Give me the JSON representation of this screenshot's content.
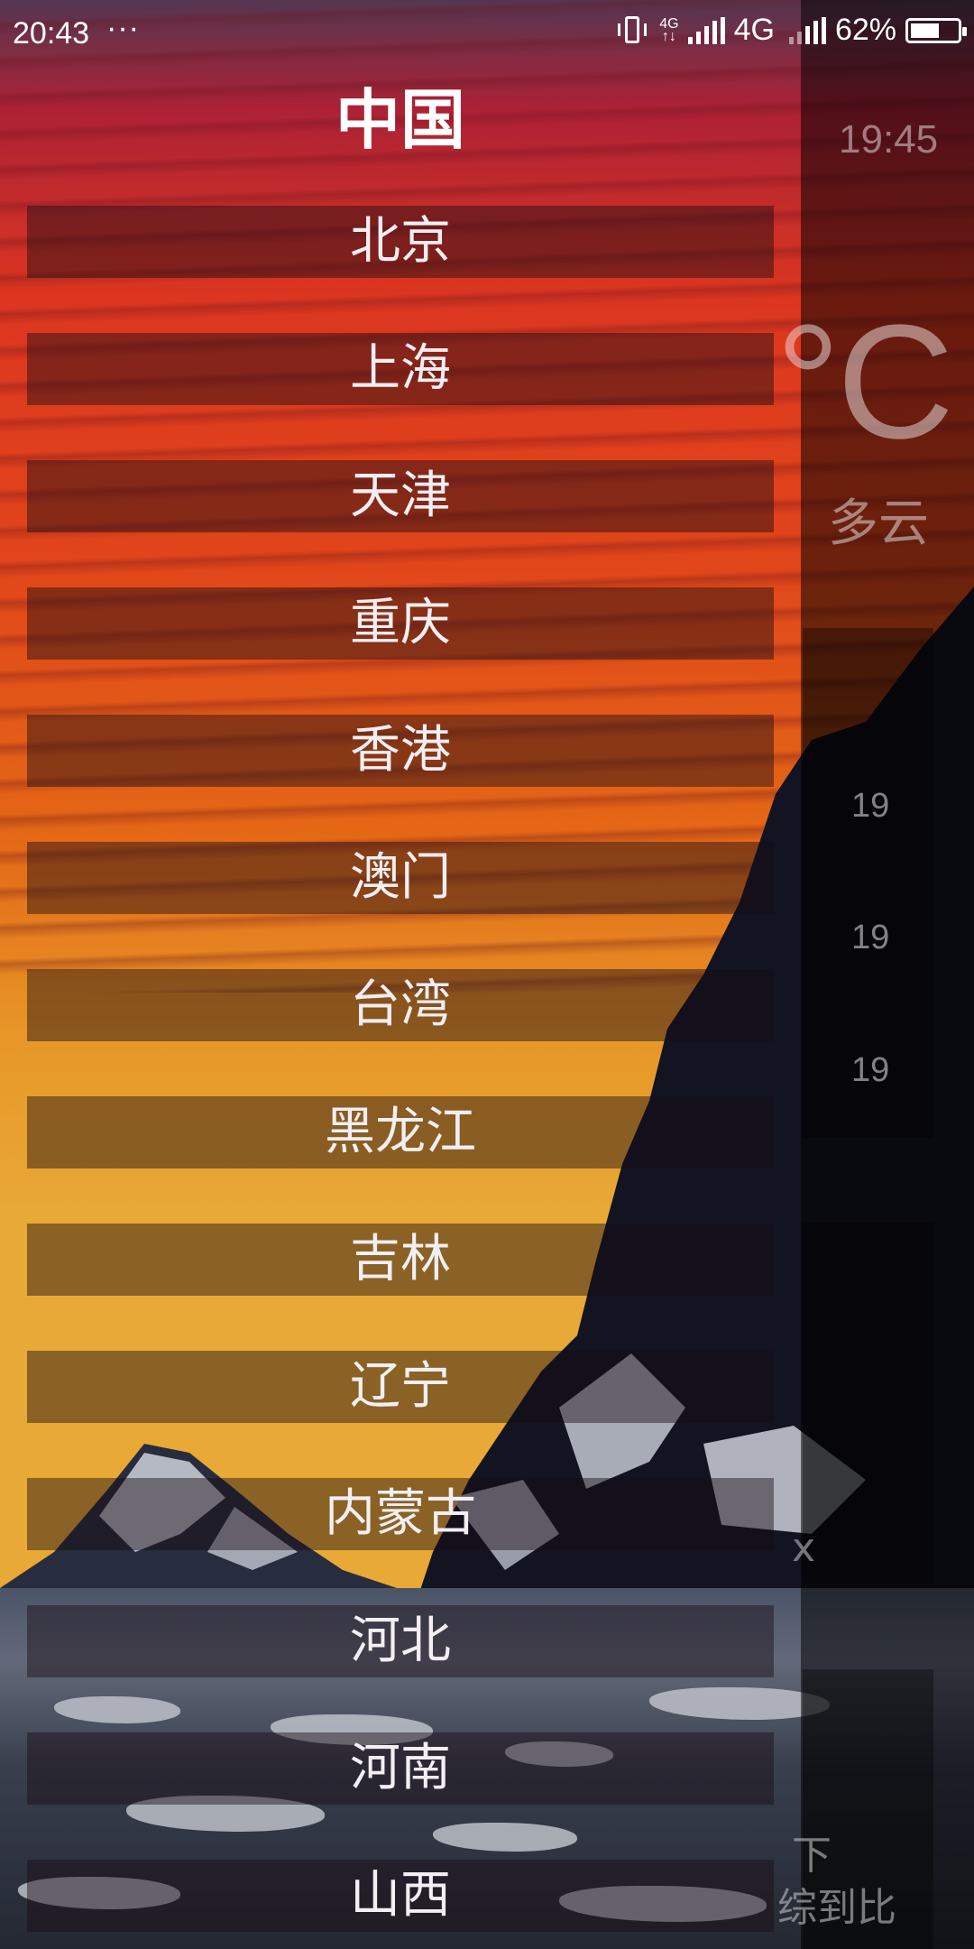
{
  "status_bar": {
    "time": "20:43",
    "more": "···",
    "network_small": "4G",
    "network": "4G",
    "battery": "62%",
    "battery_level": 0.62,
    "icons": [
      "vibrate-icon",
      "signal-icon",
      "battery-icon"
    ]
  },
  "drawer": {
    "title": "中国",
    "items": [
      "北京",
      "上海",
      "天津",
      "重庆",
      "香港",
      "澳门",
      "台湾",
      "黑龙江",
      "吉林",
      "辽宁",
      "内蒙古",
      "河北",
      "河南",
      "山西"
    ]
  },
  "main": {
    "update_time": "19:45",
    "temperature": "°C",
    "weather": "多云",
    "forecast_values": [
      "19",
      "19",
      "19"
    ],
    "partial_texts": [
      "x",
      "下",
      "综到比"
    ]
  }
}
